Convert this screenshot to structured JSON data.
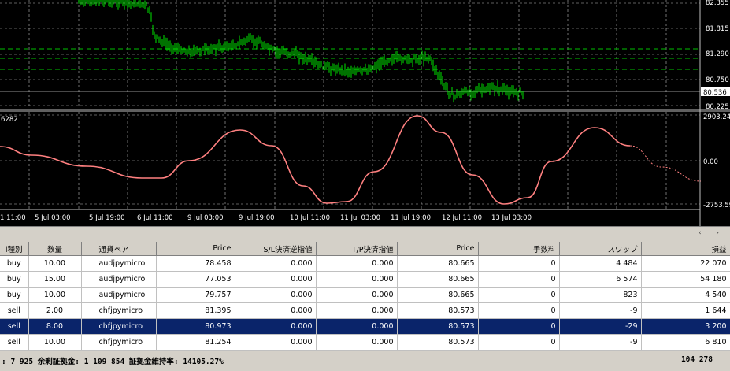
{
  "chart": {
    "price_axis_labels": [
      "82.355",
      "81.815",
      "81.290",
      "80.750",
      "80.225"
    ],
    "current_price": "80.536",
    "indicator_label": "6282",
    "indicator_axis_labels": [
      "2903.24",
      "0.00",
      "-2753.59"
    ],
    "time_labels": [
      "1 11:00",
      "5 Jul 03:00",
      "5 Jul 19:00",
      "6 Jul 11:00",
      "9 Jul 03:00",
      "9 Jul 19:00",
      "10 Jul 11:00",
      "11 Jul 03:00",
      "11 Jul 19:00",
      "12 Jul 11:00",
      "13 Jul 03:00"
    ],
    "colors": {
      "candles": "#00ff00",
      "level_lines": "#00c000",
      "indicator": "#ff8080",
      "grid": "#c0c0c0",
      "background": "#000000"
    }
  },
  "table": {
    "headers": [
      "l種別",
      "数量",
      "通貨ペア",
      "Price",
      "S/L決済逆指値",
      "T/P決済指値",
      "Price",
      "手数料",
      "スワップ",
      "損益"
    ],
    "rows": [
      [
        "buy",
        "10.00",
        "audjpymicro",
        "78.458",
        "0.000",
        "0.000",
        "80.665",
        "0",
        "4 484",
        "22 070"
      ],
      [
        "buy",
        "15.00",
        "audjpymicro",
        "77.053",
        "0.000",
        "0.000",
        "80.665",
        "0",
        "6 574",
        "54 180"
      ],
      [
        "buy",
        "10.00",
        "audjpymicro",
        "79.757",
        "0.000",
        "0.000",
        "80.665",
        "0",
        "823",
        "4 540"
      ],
      [
        "sell",
        "2.00",
        "chfjpymicro",
        "81.395",
        "0.000",
        "0.000",
        "80.573",
        "0",
        "-9",
        "1 644"
      ],
      [
        "sell",
        "8.00",
        "chfjpymicro",
        "80.973",
        "0.000",
        "0.000",
        "80.573",
        "0",
        "-29",
        "3 200"
      ],
      [
        "sell",
        "10.00",
        "chfjpymicro",
        "81.254",
        "0.000",
        "0.000",
        "80.573",
        "0",
        "-9",
        "6 810"
      ]
    ],
    "selected_row": 4
  },
  "status": {
    "left": ": 7 925  余剰証拠金: 1 109 854  証拠金維持率: 14105.27%",
    "right": "104 278"
  }
}
